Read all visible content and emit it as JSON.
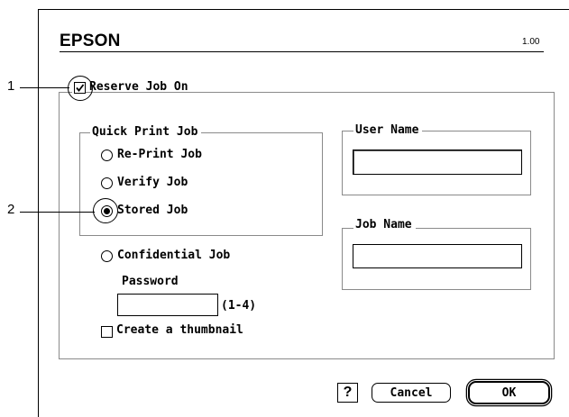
{
  "header": {
    "brand": "EPSON",
    "version": "1.00"
  },
  "reserve": {
    "label": "Reserve Job On",
    "checked": true
  },
  "quick_print": {
    "title": "Quick Print Job",
    "options": [
      {
        "label": "Re-Print Job",
        "selected": false
      },
      {
        "label": "Verify Job",
        "selected": false
      },
      {
        "label": "Stored Job",
        "selected": true
      }
    ]
  },
  "confidential": {
    "label": "Confidential Job",
    "selected": false
  },
  "password": {
    "label": "Password",
    "value": "",
    "hint": "(1-4)"
  },
  "thumbnail": {
    "label": "Create a thumbnail",
    "checked": false
  },
  "user_name": {
    "title": "User Name",
    "value": ""
  },
  "job_name": {
    "title": "Job Name",
    "value": ""
  },
  "buttons": {
    "help": "?",
    "cancel": "Cancel",
    "ok": "OK"
  },
  "callouts": [
    "1",
    "2"
  ]
}
